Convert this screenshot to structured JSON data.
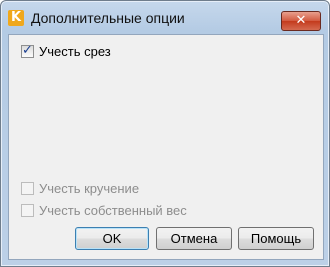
{
  "window": {
    "title": "Дополнительные опции",
    "close_glyph": "✕"
  },
  "options": [
    {
      "label": "Учесть срез",
      "checked": true,
      "enabled": true
    },
    {
      "label": "Учесть кручение",
      "checked": false,
      "enabled": false
    },
    {
      "label": "Учесть собственный вес",
      "checked": false,
      "enabled": false
    }
  ],
  "buttons": {
    "ok": "OK",
    "cancel": "Отмена",
    "help": "Помощь"
  },
  "icons": {
    "app": "app-logo-icon",
    "check": "✓"
  },
  "colors": {
    "accent": "#3c7fb1",
    "close": "#c43a1c"
  }
}
